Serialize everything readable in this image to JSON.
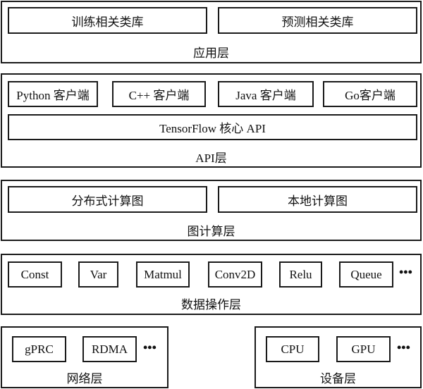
{
  "layers": {
    "application": {
      "label": "应用层",
      "items": [
        "训练相关类库",
        "预测相关类库"
      ]
    },
    "api": {
      "label": "API层",
      "clients": [
        "Python 客户端",
        "C++ 客户端",
        "Java 客户端",
        "Go客户端"
      ],
      "core": "TensorFlow 核心 API"
    },
    "graph": {
      "label": "图计算层",
      "items": [
        "分布式计算图",
        "本地计算图"
      ]
    },
    "data_ops": {
      "label": "数据操作层",
      "items": [
        "Const",
        "Var",
        "Matmul",
        "Conv2D",
        "Relu",
        "Queue"
      ],
      "more": "•••"
    },
    "network": {
      "label": "网络层",
      "items": [
        "gPRC",
        "RDMA"
      ],
      "more": "•••"
    },
    "device": {
      "label": "设备层",
      "items": [
        "CPU",
        "GPU"
      ],
      "more": "•••"
    }
  }
}
